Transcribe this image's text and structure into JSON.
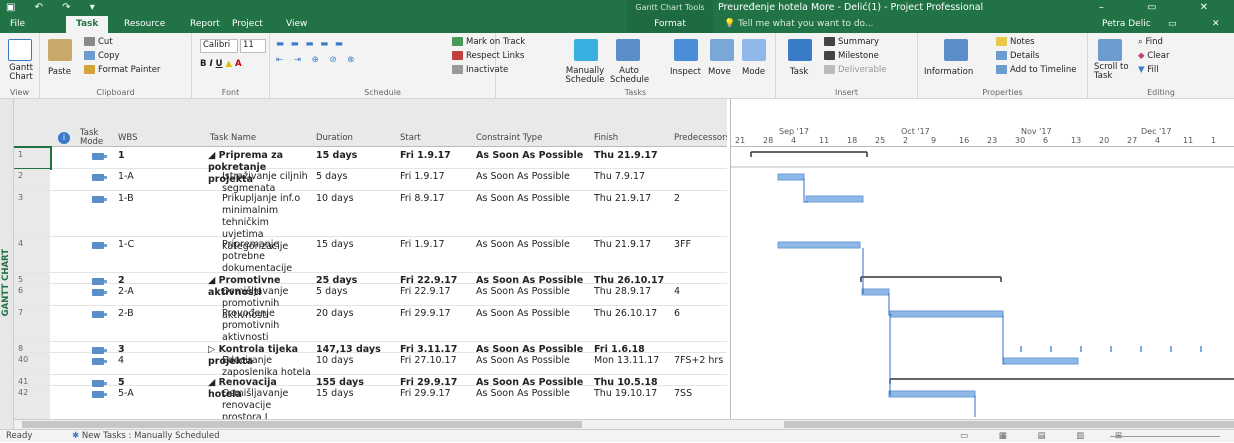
{
  "window": {
    "title": "Preuređenje hotela More - Delić(1) - Project Professional",
    "context_tab": "Gantt Chart Tools",
    "user": "Petra Delic"
  },
  "tabs": [
    "File",
    "Task",
    "Resource",
    "Report",
    "Project",
    "View",
    "Format"
  ],
  "tell_me": "Tell me what you want to do...",
  "ribbon": {
    "view": {
      "gantt": "Gantt Chart",
      "label": "View"
    },
    "clipboard": {
      "paste": "Paste",
      "cut": "Cut",
      "copy": "Copy",
      "format_painter": "Format Painter",
      "label": "Clipboard"
    },
    "font": {
      "name": "Calibri",
      "size": "11",
      "label": "Font"
    },
    "schedule": {
      "mark": "Mark on Track",
      "respect": "Respect Links",
      "inactivate": "Inactivate",
      "label": "Schedule"
    },
    "tasks": {
      "manual": "Manually Schedule",
      "auto": "Auto Schedule",
      "inspect": "Inspect",
      "move": "Move",
      "mode": "Mode",
      "label": "Tasks"
    },
    "insert": {
      "task": "Task",
      "summary": "Summary",
      "milestone": "Milestone",
      "deliverable": "Deliverable",
      "label": "Insert"
    },
    "properties": {
      "information": "Information",
      "notes": "Notes",
      "details": "Details",
      "add_timeline": "Add to Timeline",
      "label": "Properties"
    },
    "editing": {
      "scroll": "Scroll to Task",
      "find": "Find",
      "clear": "Clear",
      "fill": "Fill",
      "label": "Editing"
    }
  },
  "side_label": "GANTT CHART",
  "columns": {
    "info": "i",
    "mode": "Task Mode",
    "wbs": "WBS",
    "name": "Task Name",
    "duration": "Duration",
    "start": "Start",
    "constraint": "Constraint Type",
    "finish": "Finish",
    "pred": "Predecessors"
  },
  "rows": [
    {
      "id": "1",
      "wbs": "1",
      "name": "◢ Priprema za pokretanje projekta",
      "duration": "15 days",
      "start": "Fri 1.9.17",
      "constraint": "As Soon As Possible",
      "finish": "Thu 21.9.17",
      "pred": ""
    },
    {
      "id": "2",
      "wbs": "1-A",
      "name": "Istraživanje ciljnih segmenata",
      "duration": "5 days",
      "start": "Fri 1.9.17",
      "constraint": "As Soon As Possible",
      "finish": "Thu 7.9.17",
      "pred": ""
    },
    {
      "id": "3",
      "wbs": "1-B",
      "name": "Prikupljanje inf.o minimalnim tehničkim uvjetima kategorizacije",
      "duration": "10 days",
      "start": "Fri 8.9.17",
      "constraint": "As Soon As Possible",
      "finish": "Thu 21.9.17",
      "pred": "2"
    },
    {
      "id": "4",
      "wbs": "1-C",
      "name": "Pripremanje potrebne dokumentacije",
      "duration": "15 days",
      "start": "Fri 1.9.17",
      "constraint": "As Soon As Possible",
      "finish": "Thu 21.9.17",
      "pred": "3FF"
    },
    {
      "id": "5",
      "wbs": "2",
      "name": "◢ Promotivne aktivnosti",
      "duration": "25 days",
      "start": "Fri 22.9.17",
      "constraint": "As Soon As Possible",
      "finish": "Thu 26.10.17",
      "pred": ""
    },
    {
      "id": "6",
      "wbs": "2-A",
      "name": "Osmišljavanje promotivnih aktivnosti",
      "duration": "5 days",
      "start": "Fri 22.9.17",
      "constraint": "As Soon As Possible",
      "finish": "Thu 28.9.17",
      "pred": "4"
    },
    {
      "id": "7",
      "wbs": "2-B",
      "name": "Provođenje promotivnih aktivnosti",
      "duration": "20 days",
      "start": "Fri 29.9.17",
      "constraint": "As Soon As Possible",
      "finish": "Thu 26.10.17",
      "pred": "6"
    },
    {
      "id": "8",
      "wbs": "3",
      "name": "▷ Kontrola tijeka projekta",
      "duration": "147,13 days",
      "start": "Fri 3.11.17",
      "constraint": "As Soon As Possible",
      "finish": "Fri 1.6.18",
      "pred": ""
    },
    {
      "id": "40",
      "wbs": "4",
      "name": "Educiranje zaposlenika hotela",
      "duration": "10 days",
      "start": "Fri 27.10.17",
      "constraint": "As Soon As Possible",
      "finish": "Mon 13.11.17",
      "pred": "7FS+2 hrs"
    },
    {
      "id": "41",
      "wbs": "5",
      "name": "◢ Renovacija hotela",
      "duration": "155 days",
      "start": "Fri 29.9.17",
      "constraint": "As Soon As Possible",
      "finish": "Thu 10.5.18",
      "pred": ""
    },
    {
      "id": "42",
      "wbs": "5-A",
      "name": "Osmišljavanje renovacije prostora I uvođenja sadržaja",
      "duration": "15 days",
      "start": "Fri 29.9.17",
      "constraint": "As Soon As Possible",
      "finish": "Thu 19.10.17",
      "pred": "7SS"
    }
  ],
  "timescale": {
    "months": [
      "Sep '17",
      "Oct '17",
      "Nov '17",
      "Dec '17"
    ],
    "days": [
      "21",
      "28",
      "4",
      "11",
      "18",
      "25",
      "2",
      "9",
      "16",
      "23",
      "30",
      "6",
      "13",
      "20",
      "27",
      "4",
      "11",
      "1"
    ]
  },
  "status": {
    "ready": "Ready",
    "new_tasks": "New Tasks : Manually Scheduled"
  },
  "colors": {
    "accent": "#217346",
    "bar": "#8fb8e8",
    "summary": "#333333",
    "link": "#2f6fc0"
  }
}
